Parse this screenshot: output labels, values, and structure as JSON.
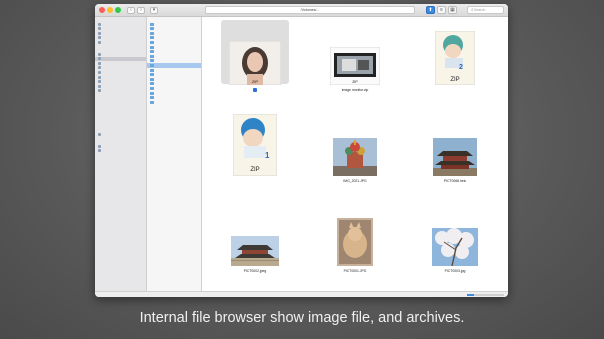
{
  "window": {
    "path": "/Volumes/...",
    "search_placeholder": "Search",
    "status": "",
    "load_progress": 0.2
  },
  "sidebar": {
    "sections": [
      {
        "header": "",
        "items": [
          "",
          "",
          "",
          "",
          ""
        ]
      },
      {
        "header": "",
        "items": [
          "",
          "",
          "",
          "",
          "",
          "",
          "",
          "",
          ""
        ]
      },
      {
        "header": "",
        "items": [
          ""
        ]
      },
      {
        "header": "",
        "items": [
          "",
          ""
        ]
      }
    ]
  },
  "tree": {
    "header": "",
    "items": [
      "",
      "",
      "",
      "",
      "",
      "",
      "",
      "",
      "",
      "",
      "",
      "",
      "",
      "",
      "",
      "",
      "",
      ""
    ],
    "selected_index": 9
  },
  "files": [
    {
      "name": "",
      "info": "",
      "thumb": "portrait"
    },
    {
      "name": "image monitor.zip",
      "info": "",
      "thumb": "monitor"
    },
    {
      "name": "",
      "info": "",
      "thumb": "manga2"
    },
    {
      "name": "",
      "info": "",
      "thumb": "manga1"
    },
    {
      "name": "IMG_2021.JPG",
      "info": "",
      "thumb": "church"
    },
    {
      "name": "PICT0068.heic",
      "info": "",
      "thumb": "temple"
    },
    {
      "name": "PICT0002.jpeg",
      "info": "",
      "thumb": "palace"
    },
    {
      "name": "PICT0001.JPG",
      "info": "",
      "thumb": "cat"
    },
    {
      "name": "PICT0003.jpg",
      "info": "",
      "thumb": "blossom"
    }
  ],
  "caption": {
    "line1": "Internal file browser show image file, and archives.",
    "line2": ""
  },
  "colors": {
    "selection": "#2f6fd6",
    "folder": "#69a6de",
    "tree_selection": "#a9c8ef"
  }
}
